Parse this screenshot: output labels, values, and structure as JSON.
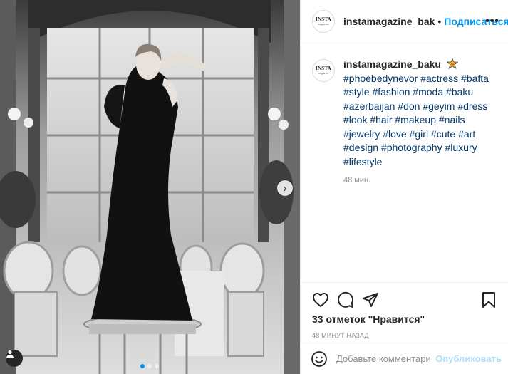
{
  "post": {
    "author": "instamagazine_baku",
    "author_truncated": "instamagazine_bak",
    "follow_label": "Подписаться",
    "avatar_text_main": "INSTA",
    "avatar_text_sub": "magazine",
    "badge_icon": "star-badge-icon",
    "caption_hashtags": [
      "#phoebedynevor",
      "#actress",
      "#bafta",
      "#style",
      "#fashion",
      "#moda",
      "#baku",
      "#azerbaijan",
      "#don",
      "#geyim",
      "#dress",
      "#look",
      "#hair",
      "#makeup",
      "#nails",
      "#jewelry",
      "#love",
      "#girl",
      "#cute",
      "#art",
      "#design",
      "#photography",
      "#luxury",
      "#lifestyle"
    ],
    "caption_time": "48 мин.",
    "likes_text": "33 отметок \"Нравится\"",
    "timestamp": "48 минут назад",
    "carousel": {
      "count": 3,
      "active_index": 0
    }
  },
  "comment": {
    "placeholder": "Добавьте комментарий...",
    "publish_label": "Опубликовать"
  },
  "icons": {
    "like": "heart-icon",
    "comment": "comment-icon",
    "share": "share-icon",
    "save": "bookmark-icon",
    "emoji": "emoji-icon",
    "more": "more-options-icon",
    "next": "chevron-right-icon",
    "tag": "user-tag-icon"
  },
  "colors": {
    "link_blue": "#0095f6",
    "hashtag": "#00376b",
    "muted": "#8e8e8e",
    "publish_disabled": "#b2dffc"
  }
}
